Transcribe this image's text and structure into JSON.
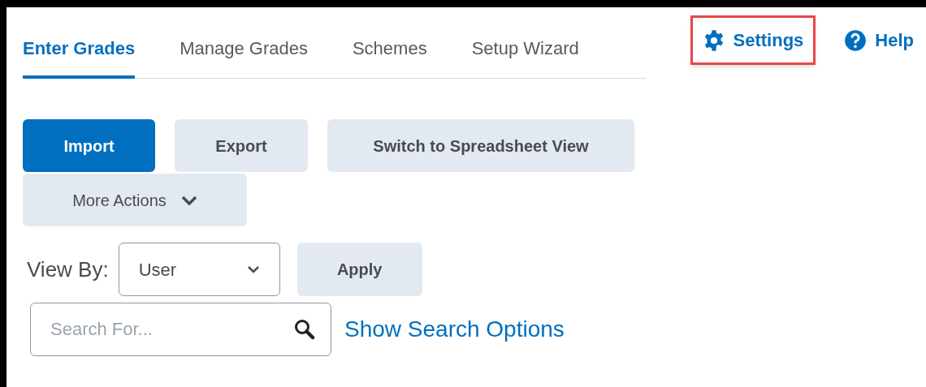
{
  "tabs": [
    {
      "label": "Enter Grades",
      "selected": true
    },
    {
      "label": "Manage Grades",
      "selected": false
    },
    {
      "label": "Schemes",
      "selected": false
    },
    {
      "label": "Setup Wizard",
      "selected": false
    }
  ],
  "links": [
    {
      "kind": "settings",
      "label": "Settings",
      "highlighted": true
    },
    {
      "kind": "help",
      "label": "Help",
      "highlighted": false
    }
  ],
  "actions": [
    {
      "label": "Import",
      "primary": true
    },
    {
      "label": "Export",
      "primary": false
    },
    {
      "label": "Switch to Spreadsheet View",
      "primary": false
    }
  ],
  "more_actions": {
    "label": "More Actions"
  },
  "view_by": {
    "label": "View By:",
    "value": "User",
    "apply": "Apply"
  },
  "search": {
    "placeholder": "Search For...",
    "options_link": "Show Search Options"
  }
}
